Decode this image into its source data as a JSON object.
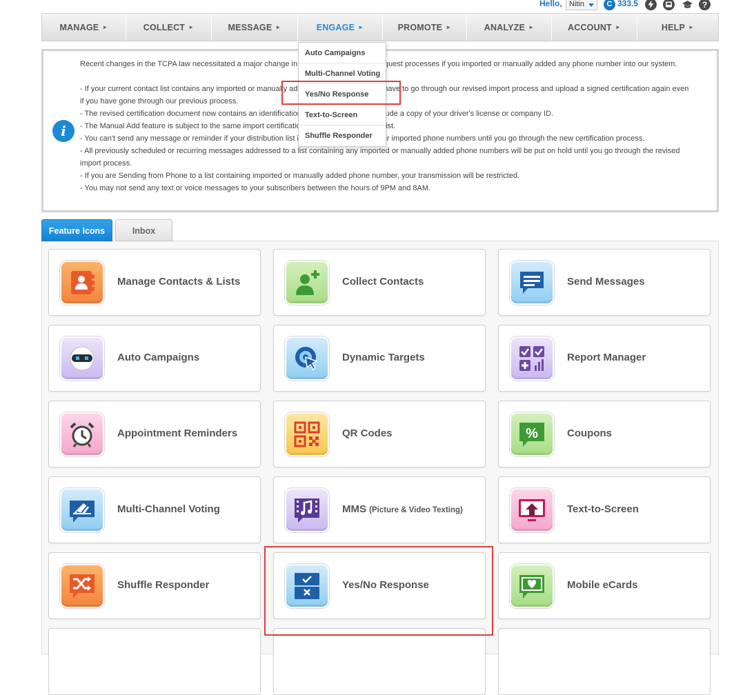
{
  "header": {
    "greeting": "Hello,",
    "user_name": "Nitin",
    "credit_symbol": "C",
    "credits": "333.5",
    "icons": [
      "lightning-icon",
      "inbox-tray-icon",
      "graduation-cap-icon",
      "help-circle-icon"
    ]
  },
  "nav": {
    "items": [
      {
        "label": "MANAGE",
        "arrow": "►"
      },
      {
        "label": "COLLECT",
        "arrow": "►"
      },
      {
        "label": "MESSAGE",
        "arrow": "►"
      },
      {
        "label": "ENGAGE",
        "arrow": "►"
      },
      {
        "label": "PROMOTE",
        "arrow": "►"
      },
      {
        "label": "ANALYZE",
        "arrow": "►"
      },
      {
        "label": "ACCOUNT",
        "arrow": "►"
      },
      {
        "label": "HELP",
        "arrow": "►"
      }
    ],
    "active_index": 3,
    "dropdown": [
      {
        "label": "Auto Campaigns"
      },
      {
        "label": "Multi-Channel Voting"
      },
      {
        "label": "Yes/No Response"
      },
      {
        "label": "Text-to-Screen"
      },
      {
        "label": "Shuffle Responder"
      }
    ],
    "dropdown_highlighted_index": 2
  },
  "notice": {
    "icon": "i",
    "lines": [
      "Recent changes in the TCPA law necessitated a major change in our Import and Import Request processes if you imported or manually added any phone number into our system.",
      "",
      "- If your current contact list contains any imported or manually added phone numbers, you have to go through our revised import process and upload a signed certification again even if you have gone through our previous process.",
      "- The revised certification document now contains an identification section. You need to include a copy of your driver's license or company ID.",
      "- The Manual Add feature is subject to the same import certification to update your contact list.",
      "- You can't send any message or reminder if your distribution list includes manually added or imported phone numbers until you go through the new certification process.",
      "- All previously scheduled or recurring messages addressed to a list containing any imported or manually added phone numbers will be put on hold until you go through the revised import process.",
      "- If you are Sending from Phone to a list containing imported or manually added phone number, your transmission will be restricted.",
      "- You may not send any text or voice messages to your subscribers between the hours of 9PM and 8AM."
    ]
  },
  "tabs": [
    {
      "label": "Feature Icons",
      "active": true
    },
    {
      "label": "Inbox",
      "active": false
    }
  ],
  "features": [
    {
      "label": "Manage Contacts & Lists",
      "icon": "contact-book-icon",
      "color": "#f3843c"
    },
    {
      "label": "Collect Contacts",
      "icon": "add-person-icon",
      "color": "#4aa83a"
    },
    {
      "label": "Send Messages",
      "icon": "message-bubble-icon",
      "color": "#1f5fa8"
    },
    {
      "label": "Auto Campaigns",
      "icon": "robot-icon",
      "color": "#3a3a3a"
    },
    {
      "label": "Dynamic Targets",
      "icon": "target-cursor-icon",
      "color": "#1f5fa8"
    },
    {
      "label": "Report Manager",
      "icon": "report-grid-icon",
      "color": "#6b4aa0"
    },
    {
      "label": "Appointment Reminders",
      "icon": "alarm-clock-icon",
      "color": "#444444"
    },
    {
      "label": "QR Codes",
      "icon": "qr-code-icon",
      "color": "#d8402c"
    },
    {
      "label": "Coupons",
      "icon": "percent-tag-icon",
      "color": "#3f9a35"
    },
    {
      "label": "Multi-Channel Voting",
      "icon": "vote-box-icon",
      "color": "#1f5fa8"
    },
    {
      "label": "MMS",
      "sub": "(Picture & Video Texting)",
      "icon": "film-music-icon",
      "color": "#5b3a93"
    },
    {
      "label": "Text-to-Screen",
      "icon": "screen-upload-icon",
      "color": "#c2185b"
    },
    {
      "label": "Shuffle Responder",
      "icon": "shuffle-icon",
      "color": "#f3843c"
    },
    {
      "label": "Yes/No Response",
      "icon": "yes-no-icon",
      "color": "#1f5fa8"
    },
    {
      "label": "Mobile eCards",
      "icon": "heart-card-icon",
      "color": "#3f9a35"
    }
  ],
  "highlighted_feature_index": 13
}
